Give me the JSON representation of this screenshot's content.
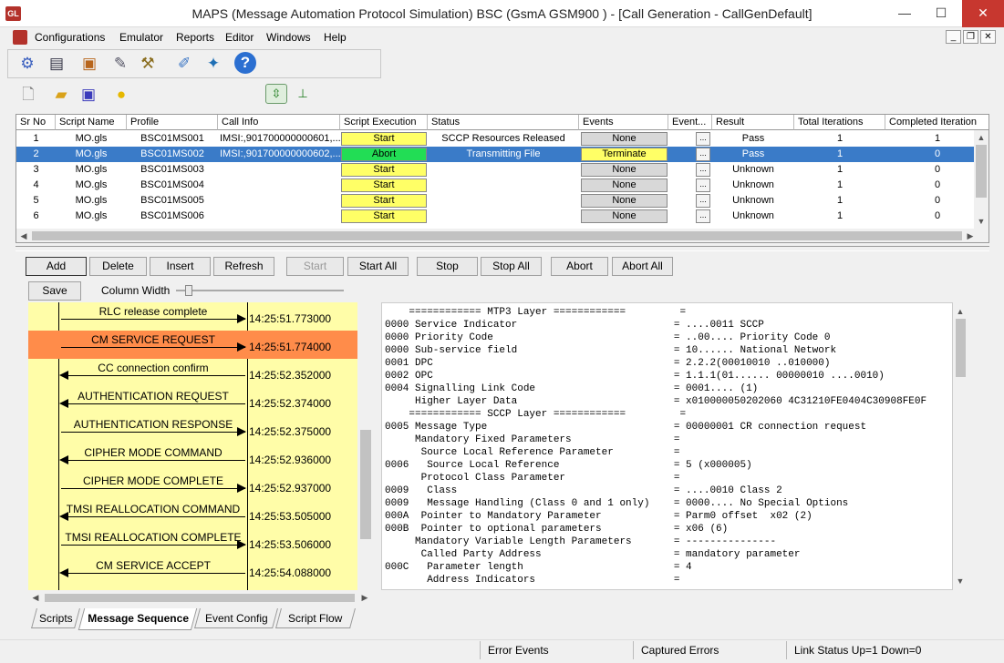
{
  "window": {
    "title": "MAPS (Message Automation Protocol Simulation) BSC (GsmA GSM900 ) - [Call Generation - CallGenDefault]",
    "app_icon_text": "GL",
    "minimize": "—",
    "maximize": "☐",
    "close": "✕"
  },
  "menu": [
    "Configurations",
    "Emulator",
    "Reports",
    "Editor",
    "Windows",
    "Help"
  ],
  "toolbar1_icons": [
    "gear-icon",
    "script-editor-icon",
    "briefcase-icon",
    "profile-editor-icon",
    "batch-icon",
    "edit-icon",
    "user-config-icon",
    "help-icon"
  ],
  "toolbar2_icons": [
    "new-file-icon",
    "open-folder-icon",
    "save-icon",
    "idea-icon",
    "vertical-layout-icon",
    "tree-layout-icon"
  ],
  "grid": {
    "headers": [
      "Sr No",
      "Script Name",
      "Profile",
      "Call Info",
      "Script Execution",
      "Status",
      "Events",
      "Event...",
      "Result",
      "Total Iterations",
      "Completed Iteration"
    ],
    "rows": [
      {
        "sr": "1",
        "script": "MO.gls",
        "profile": "BSC01MS001",
        "callinfo": "IMSI:,901700000000601,...",
        "exec": "Start",
        "status": "SCCP Resources Released",
        "events": "None",
        "eventbtn": "...",
        "result": "Pass",
        "total": "1",
        "completed": "1"
      },
      {
        "sr": "2",
        "script": "MO.gls",
        "profile": "BSC01MS002",
        "callinfo": "IMSI:,901700000000602,...",
        "exec": "Abort",
        "status": "Transmitting File",
        "events": "Terminate",
        "eventbtn": "...",
        "result": "Pass",
        "total": "1",
        "completed": "0"
      },
      {
        "sr": "3",
        "script": "MO.gls",
        "profile": "BSC01MS003",
        "callinfo": "",
        "exec": "Start",
        "status": "",
        "events": "None",
        "eventbtn": "...",
        "result": "Unknown",
        "total": "1",
        "completed": "0"
      },
      {
        "sr": "4",
        "script": "MO.gls",
        "profile": "BSC01MS004",
        "callinfo": "",
        "exec": "Start",
        "status": "",
        "events": "None",
        "eventbtn": "...",
        "result": "Unknown",
        "total": "1",
        "completed": "0"
      },
      {
        "sr": "5",
        "script": "MO.gls",
        "profile": "BSC01MS005",
        "callinfo": "",
        "exec": "Start",
        "status": "",
        "events": "None",
        "eventbtn": "...",
        "result": "Unknown",
        "total": "1",
        "completed": "0"
      },
      {
        "sr": "6",
        "script": "MO.gls",
        "profile": "BSC01MS006",
        "callinfo": "",
        "exec": "Start",
        "status": "",
        "events": "None",
        "eventbtn": "...",
        "result": "Unknown",
        "total": "1",
        "completed": "0"
      }
    ],
    "selected_row": 1
  },
  "actions": [
    "Add",
    "Delete",
    "Insert",
    "Refresh",
    "Start",
    "Start All",
    "Stop",
    "Stop All",
    "Abort",
    "Abort All"
  ],
  "save_label": "Save",
  "column_width_label": "Column Width",
  "sequence": [
    {
      "label": "RLC release complete",
      "time": "14:25:51.773000",
      "dir": "right",
      "highlight": false
    },
    {
      "label": "CM SERVICE REQUEST",
      "time": "14:25:51.774000",
      "dir": "right",
      "highlight": true
    },
    {
      "label": "CC connection confirm",
      "time": "14:25:52.352000",
      "dir": "left",
      "highlight": false
    },
    {
      "label": "AUTHENTICATION REQUEST",
      "time": "14:25:52.374000",
      "dir": "left",
      "highlight": false
    },
    {
      "label": "AUTHENTICATION RESPONSE",
      "time": "14:25:52.375000",
      "dir": "right",
      "highlight": false
    },
    {
      "label": "CIPHER MODE COMMAND",
      "time": "14:25:52.936000",
      "dir": "left",
      "highlight": false
    },
    {
      "label": "CIPHER MODE COMPLETE",
      "time": "14:25:52.937000",
      "dir": "right",
      "highlight": false
    },
    {
      "label": "TMSI REALLOCATION COMMAND",
      "time": "14:25:53.505000",
      "dir": "left",
      "highlight": false
    },
    {
      "label": "TMSI REALLOCATION COMPLETE",
      "time": "14:25:53.506000",
      "dir": "right",
      "highlight": false
    },
    {
      "label": "CM SERVICE ACCEPT",
      "time": "14:25:54.088000",
      "dir": "left",
      "highlight": false
    }
  ],
  "decode_lines": [
    "    ============ MTP3 Layer ============         =",
    "0000 Service Indicator                          = ....0011 SCCP",
    "0000 Priority Code                              = ..00.... Priority Code 0",
    "0000 Sub-service field                          = 10...... National Network",
    "0001 DPC                                        = 2.2.2(00010010 ..010000)",
    "0002 OPC                                        = 1.1.1(01...... 00000010 ....0010)",
    "0004 Signalling Link Code                       = 0001.... (1)",
    "     Higher Layer Data                          = x010000050202060 4C31210FE0404C30908FE0F",
    "    ============ SCCP Layer ============         =",
    "0005 Message Type                               = 00000001 CR connection request",
    "     Mandatory Fixed Parameters                 =",
    "      Source Local Reference Parameter          =",
    "0006   Source Local Reference                   = 5 (x000005)",
    "      Protocol Class Parameter                  =",
    "0009   Class                                    = ....0010 Class 2",
    "0009   Message Handling (Class 0 and 1 only)    = 0000.... No Special Options",
    "000A  Pointer to Mandatory Parameter            = Parm0 offset  x02 (2)",
    "000B  Pointer to optional parameters            = x06 (6)",
    "     Mandatory Variable Length Parameters       = ---------------",
    "      Called Party Address                      = mandatory parameter",
    "000C   Parameter length                         = 4",
    "       Address Indicators                       ="
  ],
  "tabs": [
    "Scripts",
    "Message Sequence",
    "Event Config",
    "Script Flow"
  ],
  "active_tab": 1,
  "status": [
    "Error Events",
    "Captured Errors",
    "Link Status Up=1 Down=0"
  ],
  "colors": {
    "selected_row": "#3a7bc8",
    "start_button": "#ffff66",
    "abort_button": "#22dd55",
    "highlight_msg": "#ff8c4a",
    "seq_bg": "#fffda8"
  }
}
